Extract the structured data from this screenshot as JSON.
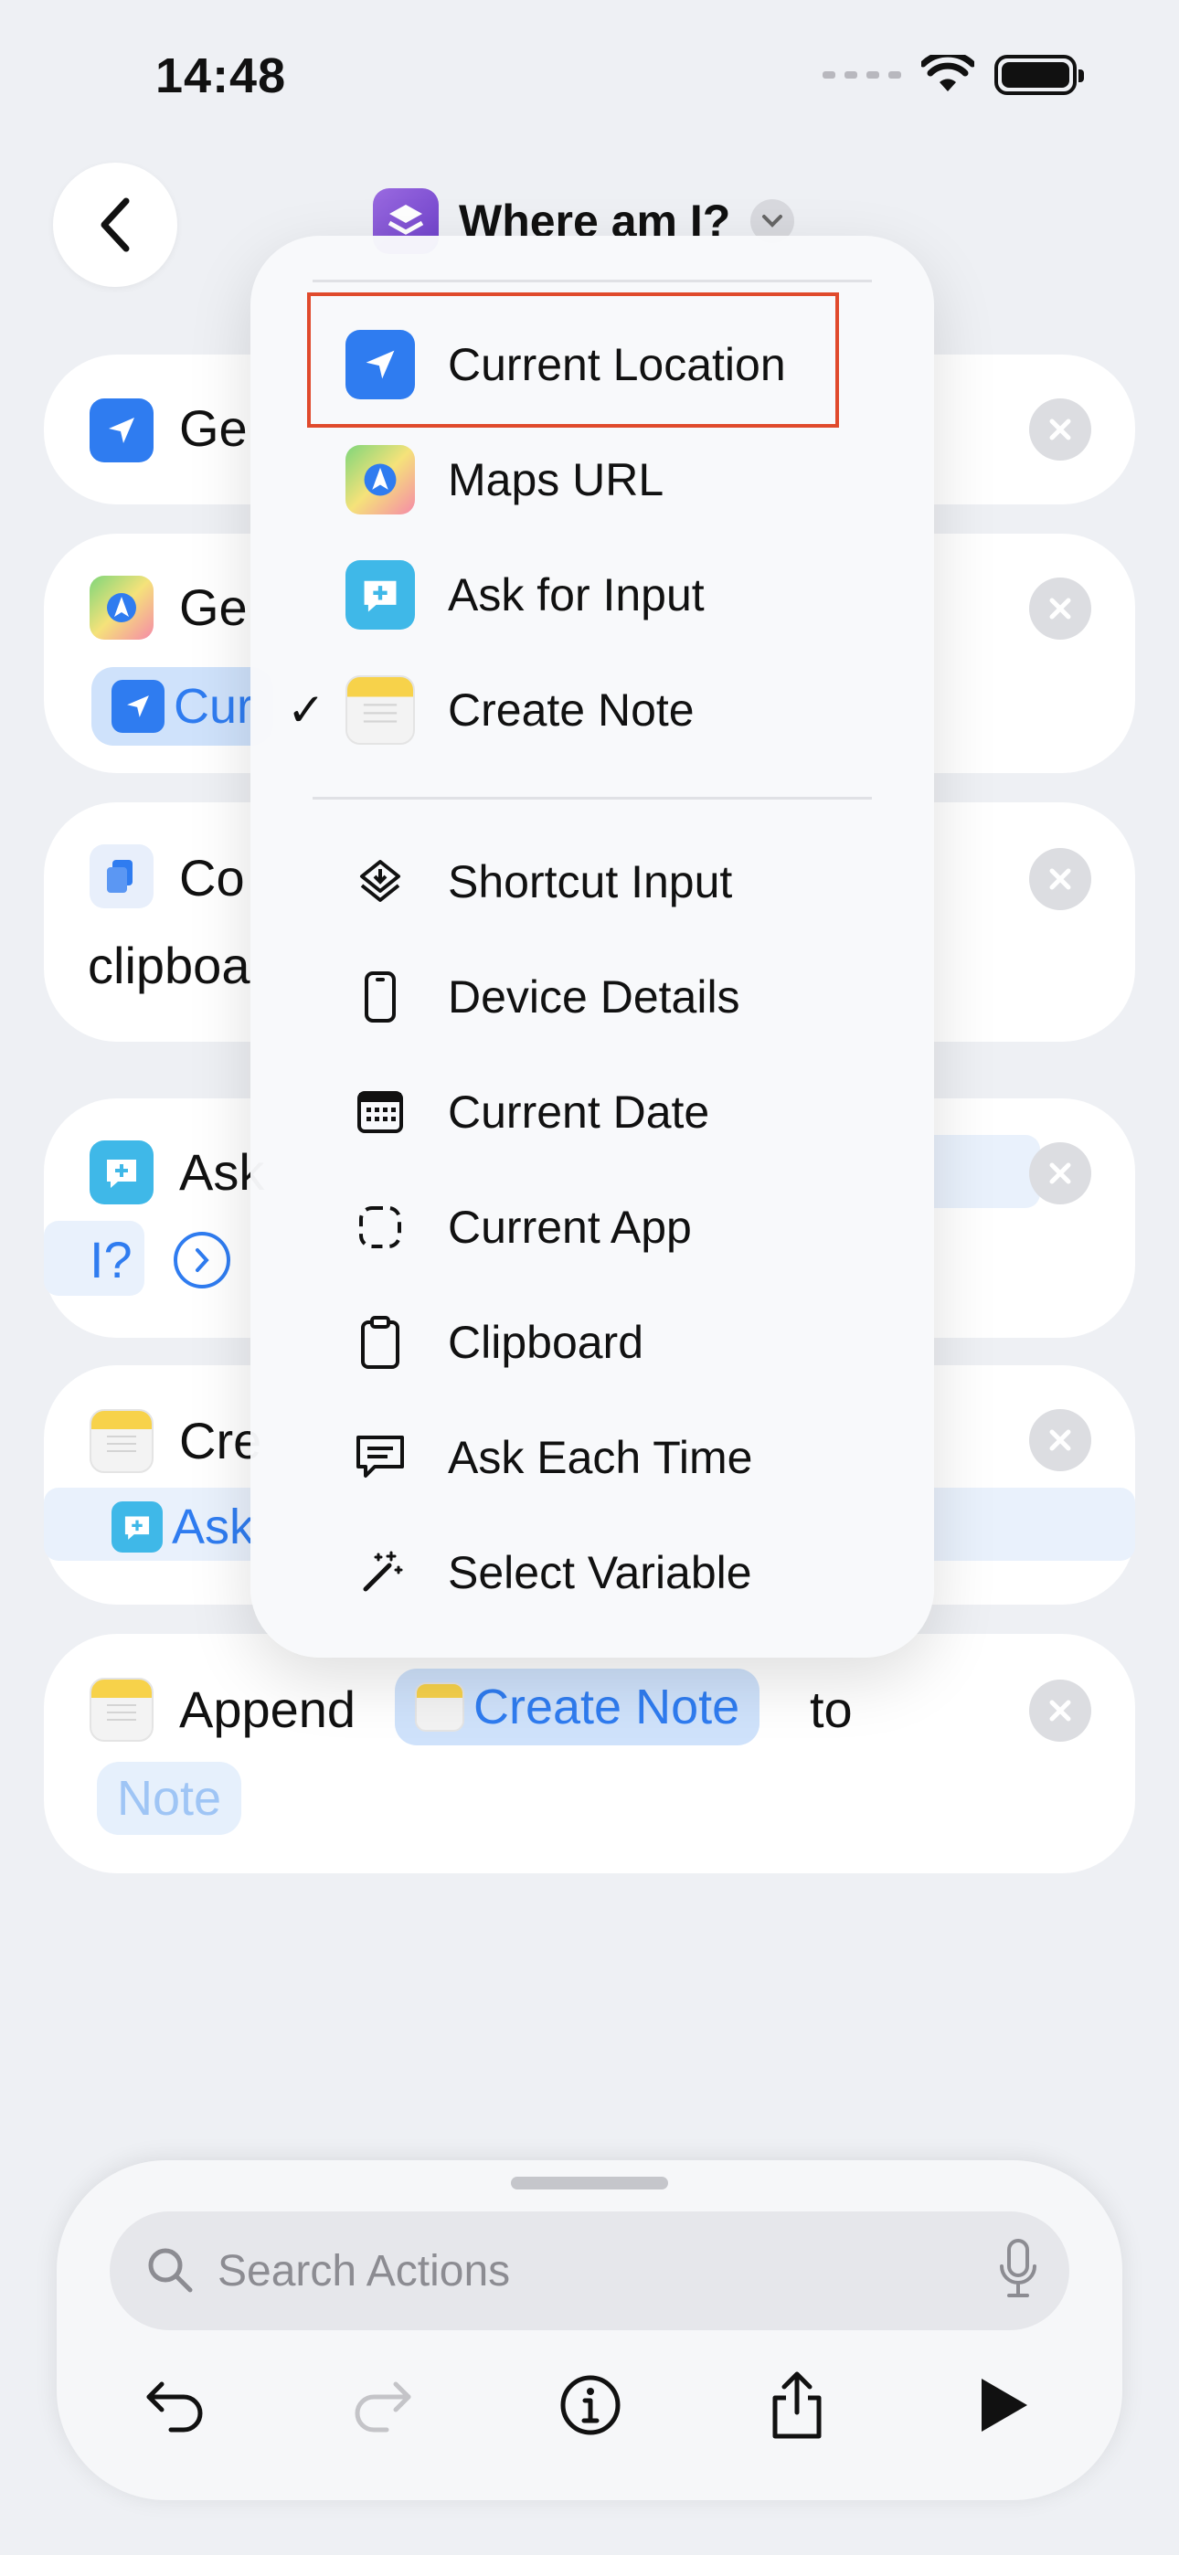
{
  "status_bar": {
    "time": "14:48"
  },
  "header": {
    "title": "Where am I?"
  },
  "actions": {
    "get_location": {
      "label": "Ge"
    },
    "get_maps": {
      "label": "Ge",
      "pill": "Cur"
    },
    "copy": {
      "label": "Co",
      "line2": "clipboa"
    },
    "ask": {
      "label": "Ask",
      "line2": "I?"
    },
    "create": {
      "label": "Cre",
      "pill": "Ask"
    },
    "append": {
      "label": "Append",
      "pill": "Create Note",
      "to": "to",
      "target": "Note"
    }
  },
  "menu": {
    "group1": [
      {
        "label": "Current Location",
        "icon": "location-arrow-icon",
        "color": "#2f7cf0",
        "checked": false
      },
      {
        "label": "Maps URL",
        "icon": "maps-icon",
        "color": "#4caf50",
        "checked": false
      },
      {
        "label": "Ask for Input",
        "icon": "speech-bubble-plus-icon",
        "color": "#3fb8e8",
        "checked": false
      },
      {
        "label": "Create Note",
        "icon": "notes-icon",
        "color": "#f7d24a",
        "checked": true
      }
    ],
    "group2": [
      {
        "label": "Shortcut Input",
        "icon": "shortcut-layers-icon"
      },
      {
        "label": "Device Details",
        "icon": "phone-icon"
      },
      {
        "label": "Current Date",
        "icon": "calendar-icon"
      },
      {
        "label": "Current App",
        "icon": "app-dashed-square-icon"
      },
      {
        "label": "Clipboard",
        "icon": "clipboard-icon"
      },
      {
        "label": "Ask Each Time",
        "icon": "speech-bubble-lines-icon"
      },
      {
        "label": "Select Variable",
        "icon": "magic-wand-icon"
      }
    ],
    "check_mark": "✓"
  },
  "bottom_sheet": {
    "search_placeholder": "Search Actions"
  },
  "colors": {
    "accent": "#2f7cf0",
    "highlight_border": "#e04a2c"
  }
}
